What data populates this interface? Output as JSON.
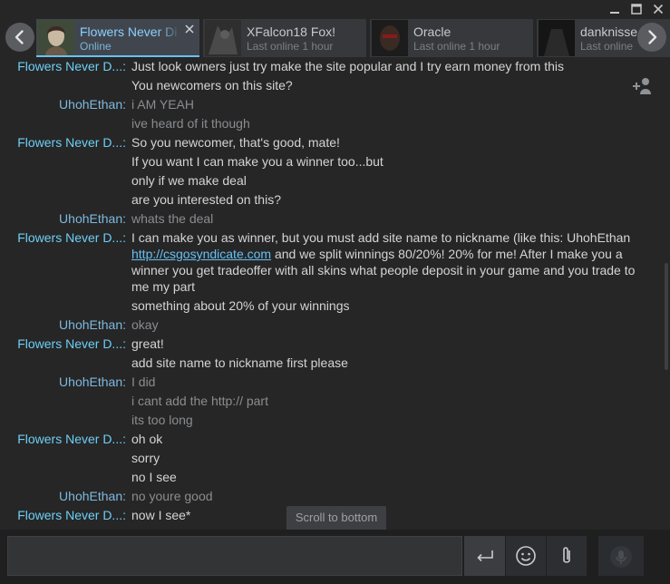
{
  "window": {
    "minimize_icon": "minimize-icon",
    "maximize_icon": "maximize-icon",
    "close_icon": "close-icon"
  },
  "tabs": [
    {
      "name": "Flowers Never Di",
      "status": "Online"
    },
    {
      "name": "XFalcon18 Fox!",
      "status": "Last online 1 hour"
    },
    {
      "name": "Oracle",
      "status": "Last online 1 hour"
    },
    {
      "name": "danknisse",
      "status": "Last online"
    }
  ],
  "messages": [
    {
      "sender": "Flowers Never D...:",
      "text": "Just look owners just try make the site popular and I try earn money from this"
    },
    {
      "sender": "",
      "text": "You newcomers on this site?"
    },
    {
      "sender": "UhohEthan:",
      "text": "i AM YEAH"
    },
    {
      "sender": "",
      "text": "ive heard of it though"
    },
    {
      "sender": "Flowers Never D...:",
      "text": "So you newcomer, that's good, mate!"
    },
    {
      "sender": "",
      "text": "If you want I can make you a winner too...but"
    },
    {
      "sender": "",
      "text": "only if we make deal"
    },
    {
      "sender": "",
      "text": "are you interested on this?"
    },
    {
      "sender": "UhohEthan:",
      "text": "whats the deal"
    },
    {
      "sender": "Flowers Never D...:",
      "text_before": "I can make you as winner, but you must add site name to nickname (like this: UhohEthan ",
      "link": "http://csgosyndicate.com",
      "text_after": " and we split winnings 80/20%! 20% for me! After I make you a winner you get tradeoffer with all skins what people deposit in your game and you trade to me my part"
    },
    {
      "sender": "",
      "text": "something about 20% of your winnings"
    },
    {
      "sender": "UhohEthan:",
      "text": "okay"
    },
    {
      "sender": "Flowers Never D...:",
      "text": "great!"
    },
    {
      "sender": "",
      "text": "add site name to nickname first please"
    },
    {
      "sender": "UhohEthan:",
      "text": "I did"
    },
    {
      "sender": "",
      "text": "i cant add the http:// part"
    },
    {
      "sender": "",
      "text": "its too long"
    },
    {
      "sender": "Flowers Never D...:",
      "text": "oh ok"
    },
    {
      "sender": "",
      "text": "sorry"
    },
    {
      "sender": "",
      "text": "no I see"
    },
    {
      "sender": "UhohEthan:",
      "text": "no youre good"
    },
    {
      "sender": "Flowers Never D...:",
      "text": "now I see*"
    }
  ],
  "scroll_to_bottom": "Scroll to bottom",
  "composer": {
    "input_value": "",
    "send_icon": "enter-icon",
    "emoji_icon": "emoji-icon",
    "attach_icon": "paperclip-icon",
    "voice_icon": "microphone-icon"
  },
  "colors": {
    "background": "#262626",
    "them_name": "#6dcff6",
    "me_name": "#7db9df",
    "message_text": "#d3d4d6",
    "link": "#66c0f4"
  }
}
